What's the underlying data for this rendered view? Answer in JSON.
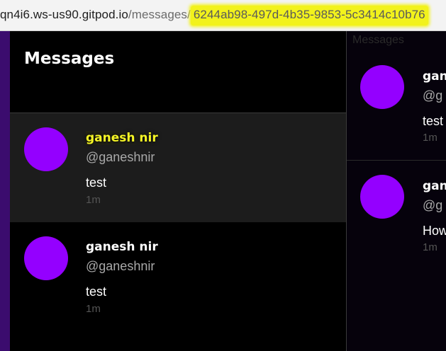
{
  "browser": {
    "url_host": "qn4i6.ws-us90.gitpod.io",
    "url_path": "/messages/",
    "url_id": "6244ab98-497d-4b35-9853-5c3414c10b76"
  },
  "messages_panel": {
    "title": "Messages",
    "items": [
      {
        "name": "ganesh nir",
        "handle": "@ganeshnir",
        "text": "test",
        "time": "1m"
      },
      {
        "name": "ganesh nir",
        "handle": "@ganeshnir",
        "text": "test",
        "time": "1m"
      }
    ]
  },
  "conversation_panel": {
    "label": "Messages",
    "items": [
      {
        "name": "gan",
        "handle": "@g",
        "text": "test",
        "time": "1m"
      },
      {
        "name": "gan",
        "handle": "@g",
        "text": "How",
        "time": "1m"
      }
    ]
  },
  "colors": {
    "avatar": "#9400ff",
    "highlight": "#f2f21c",
    "nav_strip": "#3b0c6e"
  }
}
